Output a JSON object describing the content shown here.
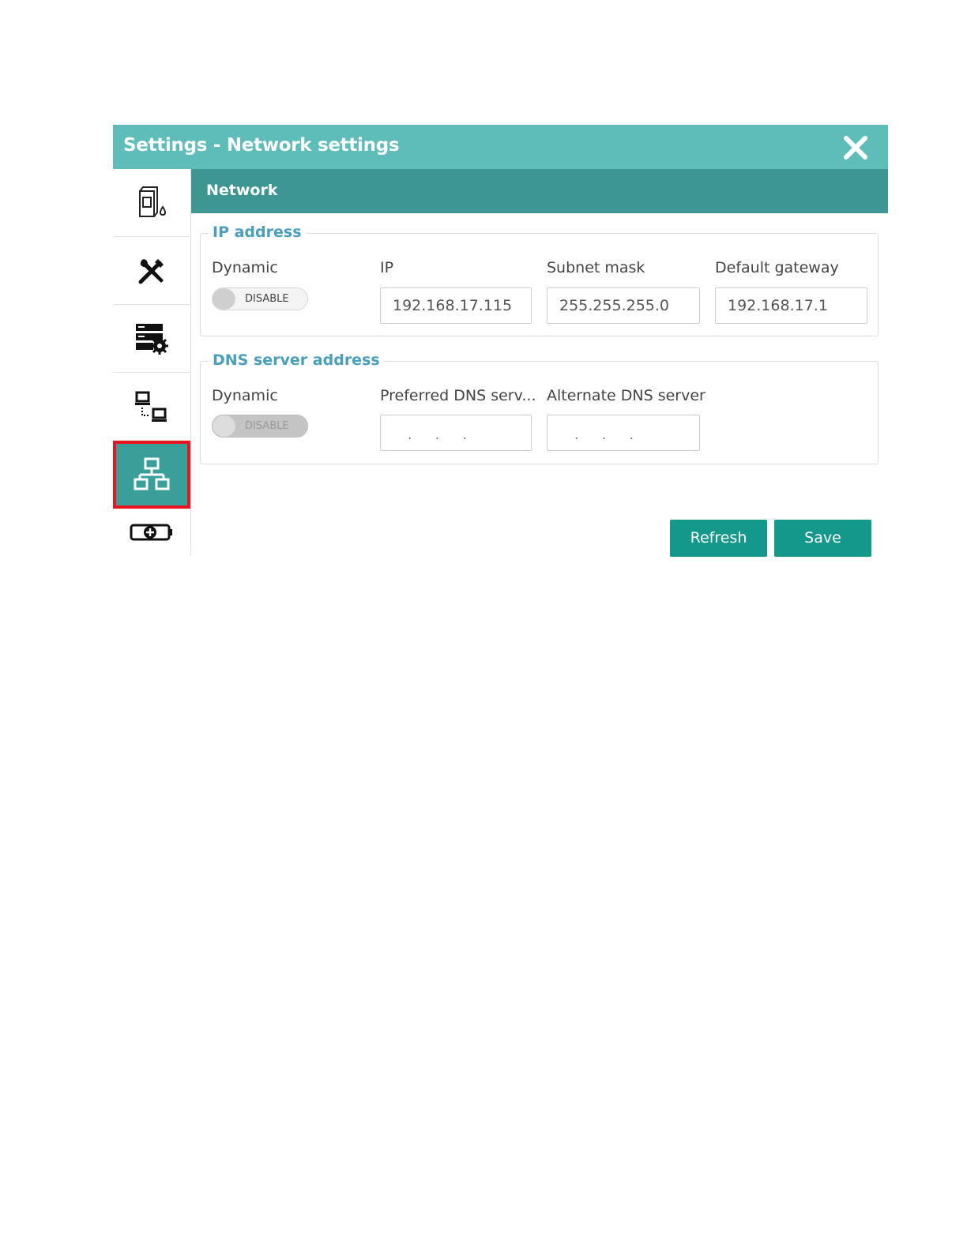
{
  "window": {
    "title": "Settings - Network settings"
  },
  "sidebar": {
    "items": [
      {
        "icon": "printer-ink-icon"
      },
      {
        "icon": "tools-icon"
      },
      {
        "icon": "server-settings-icon"
      },
      {
        "icon": "computer-connection-icon"
      },
      {
        "icon": "network-icon",
        "active": true
      },
      {
        "icon": "battery-add-icon"
      }
    ]
  },
  "section": {
    "title": "Network"
  },
  "ip_address": {
    "legend": "IP address",
    "dynamic_label": "Dynamic",
    "dynamic_toggle": "DISABLE",
    "ip_label": "IP",
    "ip_value": "192.168.17.115",
    "subnet_label": "Subnet mask",
    "subnet_value": "255.255.255.0",
    "gateway_label": "Default gateway",
    "gateway_value": "192.168.17.1"
  },
  "dns": {
    "legend": "DNS server address",
    "dynamic_label": "Dynamic",
    "dynamic_toggle": "DISABLE",
    "preferred_label": "Preferred DNS serv...",
    "preferred_value": ". . .",
    "alternate_label": "Alternate DNS server",
    "alternate_value": ". . ."
  },
  "buttons": {
    "refresh": "Refresh",
    "save": "Save"
  },
  "colors": {
    "titlebar": "#5fbdb9",
    "section_header": "#3d9691",
    "active_sidebar": "#3a9e99",
    "highlight_border": "#e8141f",
    "button": "#14988c",
    "legend": "#4a9fbd"
  }
}
